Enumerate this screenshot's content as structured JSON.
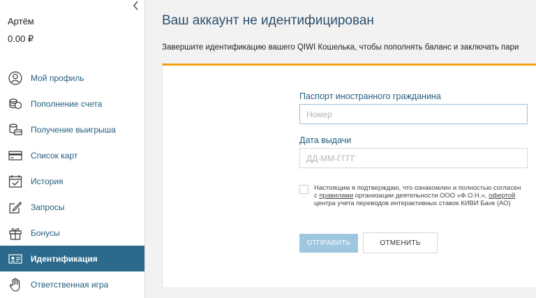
{
  "user": {
    "name": "Артём",
    "balance": "0.00 ₽"
  },
  "sidebar": {
    "collapse_icon": "chevron-left-icon",
    "items": [
      {
        "label": "Мой профиль",
        "icon": "user-icon",
        "active": false
      },
      {
        "label": "Пополнение счета",
        "icon": "coins-icon",
        "active": false
      },
      {
        "label": "Получение выигрыша",
        "icon": "cash-stack-icon",
        "active": false
      },
      {
        "label": "Список карт",
        "icon": "card-icon",
        "active": false
      },
      {
        "label": "История",
        "icon": "calendar-check-icon",
        "active": false
      },
      {
        "label": "Запросы",
        "icon": "edit-icon",
        "active": false
      },
      {
        "label": "Бонусы",
        "icon": "gift-icon",
        "active": false
      },
      {
        "label": "Идентификация",
        "icon": "id-card-icon",
        "active": true
      },
      {
        "label": "Ответственная игра",
        "icon": "hand-icon",
        "active": false
      }
    ]
  },
  "main": {
    "title": "Ваш аккаунт не идентифицирован",
    "subtitle": "Завершите идентификацию вашего QIWI Кошелька, чтобы пополнять баланс и заключать пари"
  },
  "form": {
    "passport_label": "Паспорт иностранного гражданина",
    "passport_placeholder": "Номер",
    "passport_value": "",
    "date_label": "Дата выдачи",
    "date_placeholder": "ДД-ММ-ГГГГ",
    "date_value": "",
    "consent_checked": false,
    "consent_text_1": "Настоящим я подтверждаю, что ознакомлен и полностью согласен с ",
    "consent_link_1": "правилами",
    "consent_text_2": " организации деятельности ООО «Ф.О.Н.», ",
    "consent_link_2": "офертой",
    "consent_text_3": " центра учета переводов интерактивных ставок КИВИ Банк (АО)",
    "submit_label": "ОТПРАВИТЬ",
    "cancel_label": "ОТМЕНИТЬ"
  },
  "colors": {
    "accent": "#2b6a8c",
    "link": "#245d7e",
    "orange_bar": "#f39c12",
    "submit_disabled": "#9cc7df"
  }
}
